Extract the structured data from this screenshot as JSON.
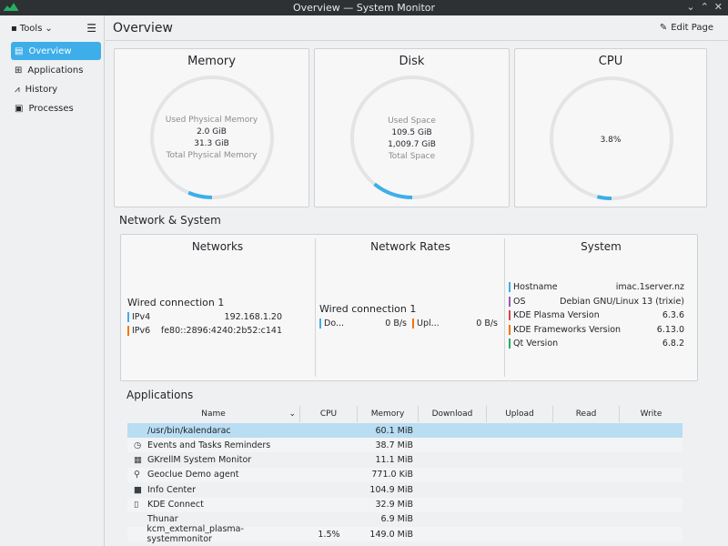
{
  "window": {
    "title": "Overview — System Monitor",
    "controls": [
      "⌄",
      "⌃",
      "✕"
    ]
  },
  "sidebar": {
    "tools_label": "Tools",
    "items": [
      {
        "label": "Overview"
      },
      {
        "label": "Applications"
      },
      {
        "label": "History"
      },
      {
        "label": "Processes"
      }
    ]
  },
  "header": {
    "title": "Overview",
    "edit_label": "Edit Page"
  },
  "memory": {
    "title": "Memory",
    "used_label": "Used Physical Memory",
    "used": "2.0 GiB",
    "total": "31.3 GiB",
    "total_label": "Total Physical Memory",
    "fraction": 0.064
  },
  "disk": {
    "title": "Disk",
    "used_label": "Used Space",
    "used": "109.5 GiB",
    "total": "1,009.7 GiB",
    "total_label": "Total Space",
    "fraction": 0.108
  },
  "cpu": {
    "title": "CPU",
    "value": "3.8%",
    "fraction": 0.038
  },
  "network_section": {
    "title": "Network & System"
  },
  "networks": {
    "title": "Networks",
    "connection": "Wired connection 1",
    "ipv4_label": "IPv4",
    "ipv4": "192.168.1.20",
    "ipv6_label": "IPv6",
    "ipv6": "fe80::2896:4240:2b52:c141"
  },
  "rates": {
    "title": "Network Rates",
    "connection": "Wired connection 1",
    "down_label": "Do...",
    "down": "0 B/s",
    "up_label": "Upl...",
    "up": "0 B/s"
  },
  "system": {
    "title": "System",
    "rows": [
      {
        "label": "Hostname",
        "value": "imac.1server.nz",
        "color": "#3daee9"
      },
      {
        "label": "OS",
        "value": "Debian GNU/Linux 13 (trixie)",
        "color": "#9b59b6"
      },
      {
        "label": "KDE Plasma Version",
        "value": "6.3.6",
        "color": "#da4453"
      },
      {
        "label": "KDE Frameworks Version",
        "value": "6.13.0",
        "color": "#f67400"
      },
      {
        "label": "Qt Version",
        "value": "6.8.2",
        "color": "#27ae60"
      }
    ]
  },
  "applications": {
    "title": "Applications",
    "columns": [
      "Name",
      "CPU",
      "Memory",
      "Download",
      "Upload",
      "Read",
      "Write"
    ],
    "rows": [
      {
        "name": "/usr/bin/kalendarac",
        "cpu": "",
        "memory": "60.1 MiB",
        "icon": ""
      },
      {
        "name": "Events and Tasks Reminders",
        "cpu": "",
        "memory": "38.7 MiB",
        "icon": "clock-icon"
      },
      {
        "name": "GKrellM System Monitor",
        "cpu": "",
        "memory": "11.1 MiB",
        "icon": "monitor-icon"
      },
      {
        "name": "Geoclue Demo agent",
        "cpu": "",
        "memory": "771.0 KiB",
        "icon": "location-icon"
      },
      {
        "name": "Info Center",
        "cpu": "",
        "memory": "104.9 MiB",
        "icon": "info-icon"
      },
      {
        "name": "KDE Connect",
        "cpu": "",
        "memory": "32.9 MiB",
        "icon": "phone-icon"
      },
      {
        "name": "Thunar",
        "cpu": "",
        "memory": "6.9 MiB",
        "icon": ""
      },
      {
        "name": "kcm_external_plasma-systemmonitor",
        "cpu": "1.5%",
        "memory": "149.0 MiB",
        "icon": ""
      }
    ]
  },
  "colors": {
    "accent": "#3daee9",
    "ipv4": "#3daee9",
    "ipv6": "#f67400",
    "down": "#3daee9",
    "up": "#f67400"
  }
}
